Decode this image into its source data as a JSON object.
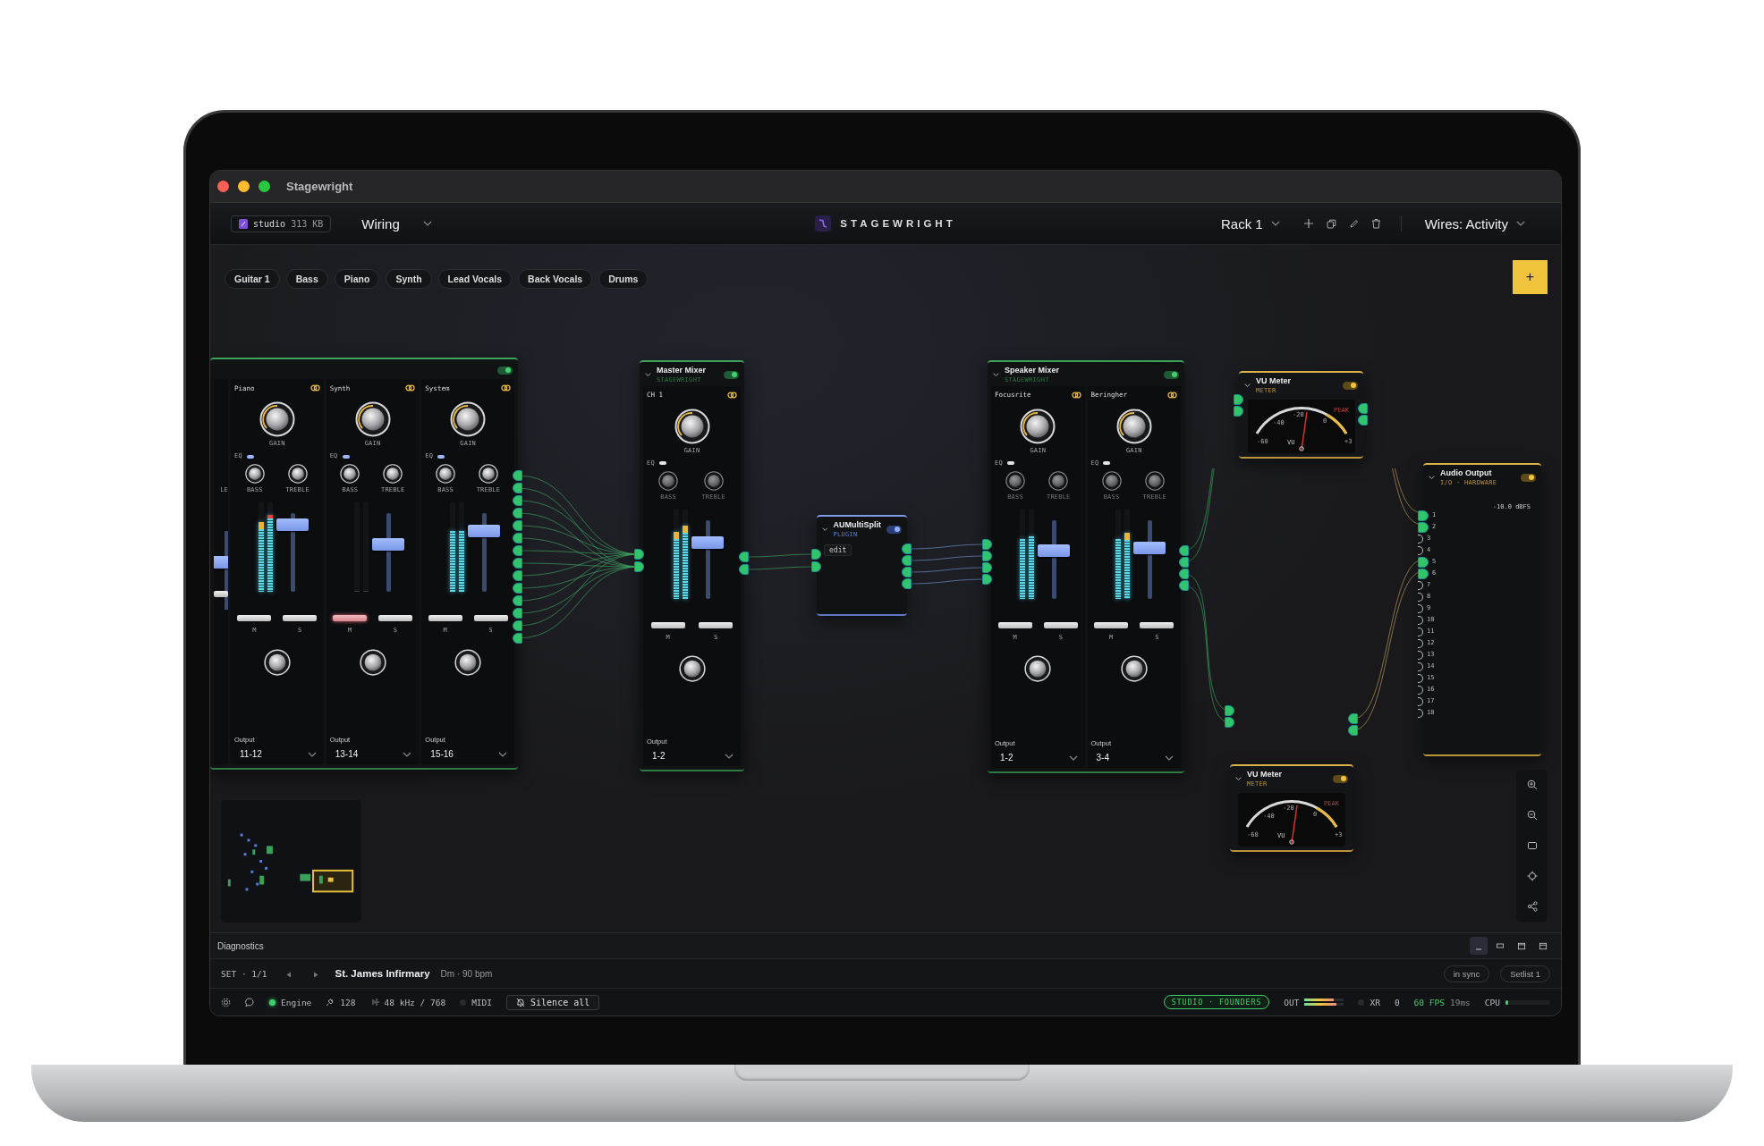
{
  "window": {
    "title": "Stagewright"
  },
  "toolbar": {
    "file_name": "studio",
    "file_size": "313 KB",
    "view": "Wiring",
    "logo": "STAGEWRIGHT",
    "rack": "Rack 1",
    "wires": "Wires: Activity"
  },
  "tags": [
    {
      "label": "Guitar 1"
    },
    {
      "label": "Bass"
    },
    {
      "label": "Piano"
    },
    {
      "label": "Synth"
    },
    {
      "label": "Lead Vocals"
    },
    {
      "label": "Back Vocals"
    },
    {
      "label": "Drums"
    }
  ],
  "add_button": "+",
  "mixers": [
    {
      "on": true,
      "strips": [
        {
          "kind": "cut",
          "treble_label": "LE",
          "fader": {
            "level": 0.6
          }
        },
        {
          "kind": "full",
          "name": "Piano",
          "linked": true,
          "gain_label": "GAIN",
          "eq_label": "EQ",
          "eq_on": true,
          "bass_label": "BASS",
          "treble_label": "TREBLE",
          "meters": [
            {
              "level": 0.78
            },
            {
              "level": 0.86
            }
          ],
          "fader": {
            "level": 0.85
          },
          "muted": false,
          "mute_label": "M",
          "solo_label": "S",
          "output_label": "Output",
          "output": "11-12"
        },
        {
          "kind": "full",
          "name": "Synth",
          "linked": true,
          "gain_label": "GAIN",
          "eq_label": "EQ",
          "eq_on": true,
          "bass_label": "BASS",
          "treble_label": "TREBLE",
          "meters": [
            {
              "level": 0
            },
            {
              "level": 0
            }
          ],
          "fader": {
            "level": 0.6
          },
          "muted": true,
          "mute_label": "M",
          "solo_label": "S",
          "output_label": "Output",
          "output": "13-14"
        },
        {
          "kind": "full",
          "name": "System",
          "linked": true,
          "gain_label": "GAIN",
          "eq_label": "EQ",
          "eq_on": true,
          "bass_label": "BASS",
          "treble_label": "TREBLE",
          "meters": [
            {
              "level": 0.68
            },
            {
              "level": 0.68
            }
          ],
          "fader": {
            "level": 0.78
          },
          "muted": false,
          "mute_label": "M",
          "solo_label": "S",
          "output_label": "Output",
          "output": "15-16"
        }
      ]
    },
    {
      "title": "Master Mixer",
      "subtitle": "STAGEWRIGHT",
      "on": true,
      "strips": [
        {
          "kind": "full",
          "name": "CH 1",
          "linked": true,
          "gain_label": "GAIN",
          "eq_label": "EQ",
          "eq_on": false,
          "bass_label": "BASS",
          "treble_label": "TREBLE",
          "meters": [
            {
              "level": 0.75
            },
            {
              "level": 0.82
            }
          ],
          "fader": {
            "level": 0.72
          },
          "muted": false,
          "mute_label": "M",
          "solo_label": "S",
          "output_label": "Output",
          "output": "1-2"
        }
      ]
    },
    {
      "title": "Speaker Mixer",
      "subtitle": "STAGEWRIGHT",
      "on": true,
      "strips": [
        {
          "kind": "full",
          "name": "Focusrite",
          "linked": true,
          "gain_label": "GAIN",
          "eq_label": "EQ",
          "eq_on": false,
          "bass_label": "BASS",
          "treble_label": "TREBLE",
          "meters": [
            {
              "level": 0.67
            },
            {
              "level": 0.7
            }
          ],
          "fader": {
            "level": 0.62
          },
          "muted": false,
          "mute_label": "M",
          "solo_label": "S",
          "output_label": "Output",
          "output": "1-2"
        },
        {
          "kind": "full",
          "name": "Beringher",
          "linked": true,
          "gain_label": "GAIN",
          "eq_label": "EQ",
          "eq_on": false,
          "bass_label": "BASS",
          "treble_label": "TREBLE",
          "meters": [
            {
              "level": 0.67
            },
            {
              "level": 0.74
            }
          ],
          "fader": {
            "level": 0.65
          },
          "muted": false,
          "mute_label": "M",
          "solo_label": "S",
          "output_label": "Output",
          "output": "3-4"
        }
      ]
    }
  ],
  "plugin": {
    "title": "AUMultiSplit",
    "subtitle": "PLUGIN",
    "on": true,
    "edit": "edit"
  },
  "vu_meters": [
    {
      "title": "VU Meter",
      "subtitle": "METER",
      "on": true,
      "scale": [
        "-60",
        "-40",
        "-20",
        "0",
        "+3"
      ],
      "unit": "VU",
      "peak": "PEAK"
    },
    {
      "title": "VU Meter",
      "subtitle": "METER",
      "on": true,
      "scale": [
        "-60",
        "-40",
        "-20",
        "0",
        "+3"
      ],
      "unit": "VU",
      "peak": "PEAK"
    }
  ],
  "audio_output": {
    "title": "Audio Output",
    "subtitle": "I/O · HARDWARE",
    "on": true,
    "reading": "-10.0 dBFS",
    "channels": [
      {
        "label": "1",
        "connected": true
      },
      {
        "label": "2",
        "connected": true
      },
      {
        "label": "3",
        "connected": false
      },
      {
        "label": "4",
        "connected": false
      },
      {
        "label": "5",
        "connected": true
      },
      {
        "label": "6",
        "connected": true
      },
      {
        "label": "7",
        "connected": false
      },
      {
        "label": "8",
        "connected": false
      },
      {
        "label": "9",
        "connected": false
      },
      {
        "label": "10",
        "connected": false
      },
      {
        "label": "11",
        "connected": false
      },
      {
        "label": "12",
        "connected": false
      },
      {
        "label": "13",
        "connected": false
      },
      {
        "label": "14",
        "connected": false
      },
      {
        "label": "15",
        "connected": false
      },
      {
        "label": "16",
        "connected": false
      },
      {
        "label": "17",
        "connected": false
      },
      {
        "label": "18",
        "connected": false
      }
    ]
  },
  "diagnostics": {
    "title": "Diagnostics",
    "layouts": [
      {
        "kind": "minimize",
        "selected": true
      },
      {
        "kind": "bottom",
        "selected": false
      },
      {
        "kind": "window",
        "selected": false
      },
      {
        "kind": "full",
        "selected": false
      }
    ]
  },
  "set_bar": {
    "set": "SET · 1/1",
    "song": "St. James Infirmary",
    "meta": "Dm · 90 bpm",
    "sync": "in sync",
    "setlist": "Setlist 1"
  },
  "status": {
    "engine": {
      "label": "Engine",
      "on": true
    },
    "voices": "128",
    "audio": "48 kHz / 768",
    "midi": {
      "label": "MIDI",
      "on": false
    },
    "silence": "Silence all",
    "license": "STUDIO · FOUNDERS",
    "out_label": "OUT",
    "out_meter": [
      {
        "level": 0.75
      },
      {
        "level": 0.8
      }
    ],
    "xr": {
      "label": "XR",
      "on": false
    },
    "xr_count": "0",
    "fps": "60 FPS",
    "latency": "19ms",
    "cpu": {
      "label": "CPU",
      "level": 0.06
    }
  }
}
